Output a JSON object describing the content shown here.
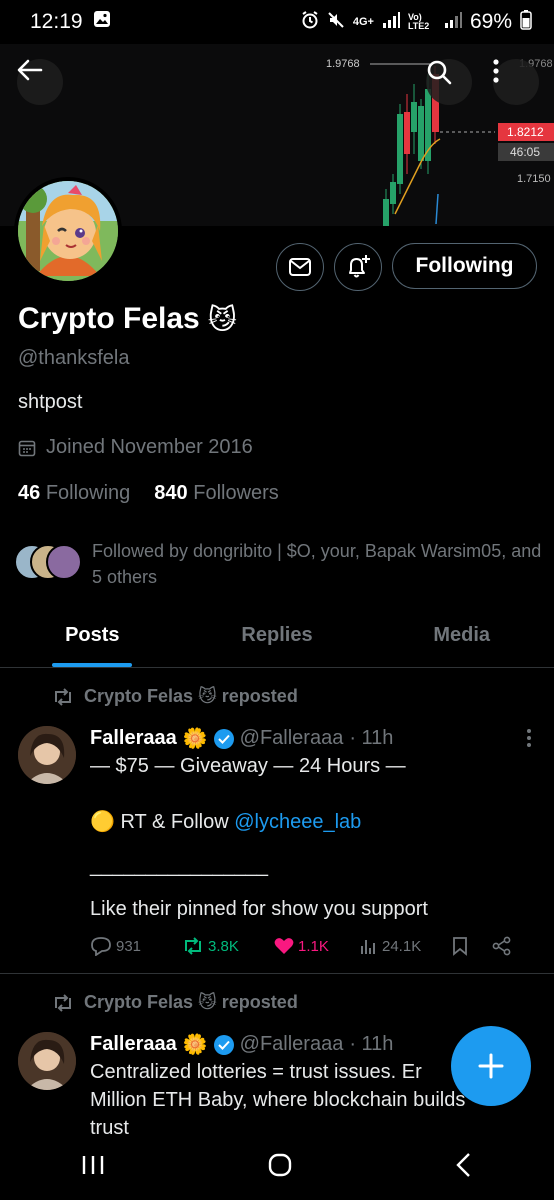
{
  "status_bar": {
    "time": "12:19",
    "network": "4G+",
    "lte": "Vo) LTE2",
    "battery": "69%"
  },
  "banner": {
    "price_top": "1.9768",
    "price_top_right": "1.9768",
    "price_current": "1.8212",
    "timer": "46:05",
    "price_low": "1.7150"
  },
  "profile": {
    "name": "Crypto Felas",
    "name_emoji": "😼",
    "handle": "@thanksfela",
    "bio": "shtpost",
    "joined": "Joined November 2016",
    "following_count": "46",
    "following_label": "Following",
    "followers_count": "840",
    "followers_label": "Followers",
    "followed_by": "Followed by dongribito | $O, your, Bapak Warsim05, and 5 others",
    "follow_button": "Following"
  },
  "tabs": [
    {
      "label": "Posts",
      "active": true
    },
    {
      "label": "Replies",
      "active": false
    },
    {
      "label": "Media",
      "active": false
    }
  ],
  "posts": [
    {
      "repost_label": "Crypto Felas 😼 reposted",
      "author": "Falleraaa",
      "author_emoji": "🌼",
      "handle": "@Falleraaa",
      "time": "· 11h",
      "line1": "— $75 — Giveaway — 24 Hours —",
      "line2_prefix": "🟡 RT & Follow ",
      "line2_mention": "@lycheee_lab",
      "line3": "________________",
      "line4": "Like their pinned for show you support",
      "replies": "931",
      "reposts": "3.8K",
      "likes": "1.1K",
      "views": "24.1K"
    },
    {
      "repost_label": "Crypto Felas 😼 reposted",
      "author": "Falleraaa",
      "author_emoji": "🌼",
      "handle": "@Falleraaa",
      "time": "· 11h",
      "line1": "Centralized lotteries = trust issues. Er",
      "line2": "Million ETH Baby, where blockchain builds",
      "line3": "trust"
    }
  ],
  "colors": {
    "accent": "#1d9bf0",
    "repost_green": "#00ba7c",
    "like_pink": "#f91880",
    "candle_green": "#26a269",
    "candle_red": "#e5363f"
  }
}
